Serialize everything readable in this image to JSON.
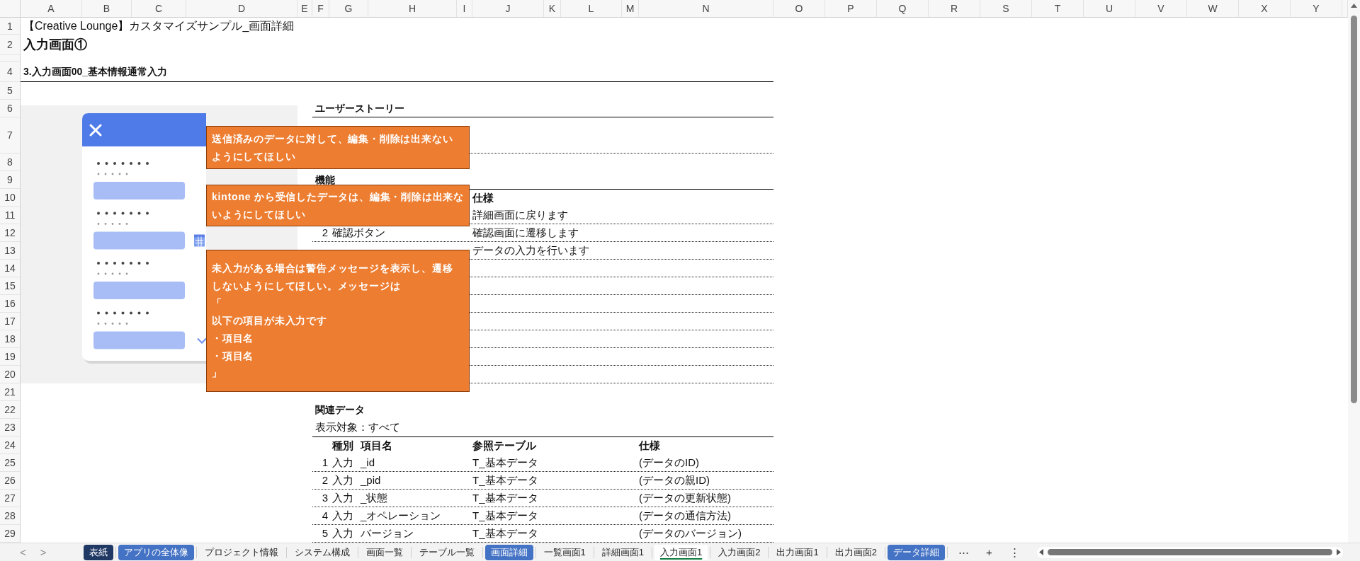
{
  "sheet": {
    "column_headers": [
      "A",
      "B",
      "C",
      "D",
      "E",
      "F",
      "G",
      "H",
      "I",
      "J",
      "K",
      "L",
      "M",
      "N",
      "O",
      "P",
      "Q",
      "R",
      "S",
      "T",
      "U",
      "V",
      "W",
      "X",
      "Y"
    ],
    "row_numbers": [
      "1",
      "2",
      "4",
      "5",
      "6",
      "7",
      "8",
      "9",
      "10",
      "11",
      "12",
      "13",
      "14",
      "15",
      "16",
      "17",
      "18",
      "19",
      "20",
      "21",
      "22",
      "23",
      "24",
      "25",
      "26",
      "27",
      "28",
      "29"
    ]
  },
  "document": {
    "title": "【Creative Lounge】カスタマイズサンプル_画面詳細",
    "heading": "入力画面①",
    "section": "3.入力画面00_基本情報通常入力"
  },
  "user_story": {
    "heading": "ユーザーストーリー"
  },
  "features": {
    "heading": "機能",
    "spec_column": "仕様",
    "rows": [
      {
        "spec": "詳細画面に戻ります"
      },
      {
        "number": "2",
        "name": "確認ボタン",
        "spec": "確認画面に遷移します"
      },
      {
        "spec": "データの入力を行います"
      }
    ]
  },
  "callouts": [
    {
      "lines": [
        "送信済みのデータに対して、編集・削除は出来ないようにしてほしい"
      ]
    },
    {
      "lines": [
        "kintone から受信したデータは、編集・削除は出来ないようにしてほしい"
      ]
    },
    {
      "lines": [
        "未入力がある場合は警告メッセージを表示し、遷移しないようにしてほしい。メッセージは",
        "「",
        "以下の項目が未入力です",
        "・項目名",
        "・項目名",
        "」"
      ]
    }
  ],
  "related_data": {
    "heading": "関連データ",
    "filter": "表示対象：すべて",
    "columns": [
      "種別",
      "項目名",
      "参照テーブル",
      "仕様"
    ],
    "rows": [
      {
        "number": "1",
        "type": "入力",
        "item": "_id",
        "table": "T_基本データ",
        "spec": "(データのID)"
      },
      {
        "number": "2",
        "type": "入力",
        "item": "_pid",
        "table": "T_基本データ",
        "spec": "(データの親ID)"
      },
      {
        "number": "3",
        "type": "入力",
        "item": "_状態",
        "table": "T_基本データ",
        "spec": "(データの更新状態)"
      },
      {
        "number": "4",
        "type": "入力",
        "item": "_オペレーション",
        "table": "T_基本データ",
        "spec": "(データの通信方法)"
      },
      {
        "number": "5",
        "type": "入力",
        "item": "バージョン",
        "table": "T_基本データ",
        "spec": "(データのバージョン)"
      }
    ]
  },
  "sheet_tabs": [
    {
      "label": "表紙",
      "color": "#203864",
      "selected": false
    },
    {
      "label": "アプリの全体像",
      "color": "#4472c4",
      "selected": false
    },
    {
      "label": "プロジェクト情報",
      "selected": false
    },
    {
      "label": "システム構成",
      "selected": false
    },
    {
      "label": "画面一覧",
      "selected": false
    },
    {
      "label": "テーブル一覧",
      "selected": false
    },
    {
      "label": "画面詳細",
      "color": "#4472c4",
      "selected": false
    },
    {
      "label": "一覧画面1",
      "selected": false
    },
    {
      "label": "詳細画面1",
      "selected": false
    },
    {
      "label": "入力画面1",
      "selected": true
    },
    {
      "label": "入力画面2",
      "selected": false
    },
    {
      "label": "出力画面1",
      "selected": false
    },
    {
      "label": "出力画面2",
      "selected": false
    },
    {
      "label": "データ詳細",
      "color": "#4472c4",
      "selected": false
    }
  ],
  "tab_bar": {
    "prev": "<",
    "next": ">",
    "more": "⋯",
    "add": "+",
    "options": "⋮"
  }
}
